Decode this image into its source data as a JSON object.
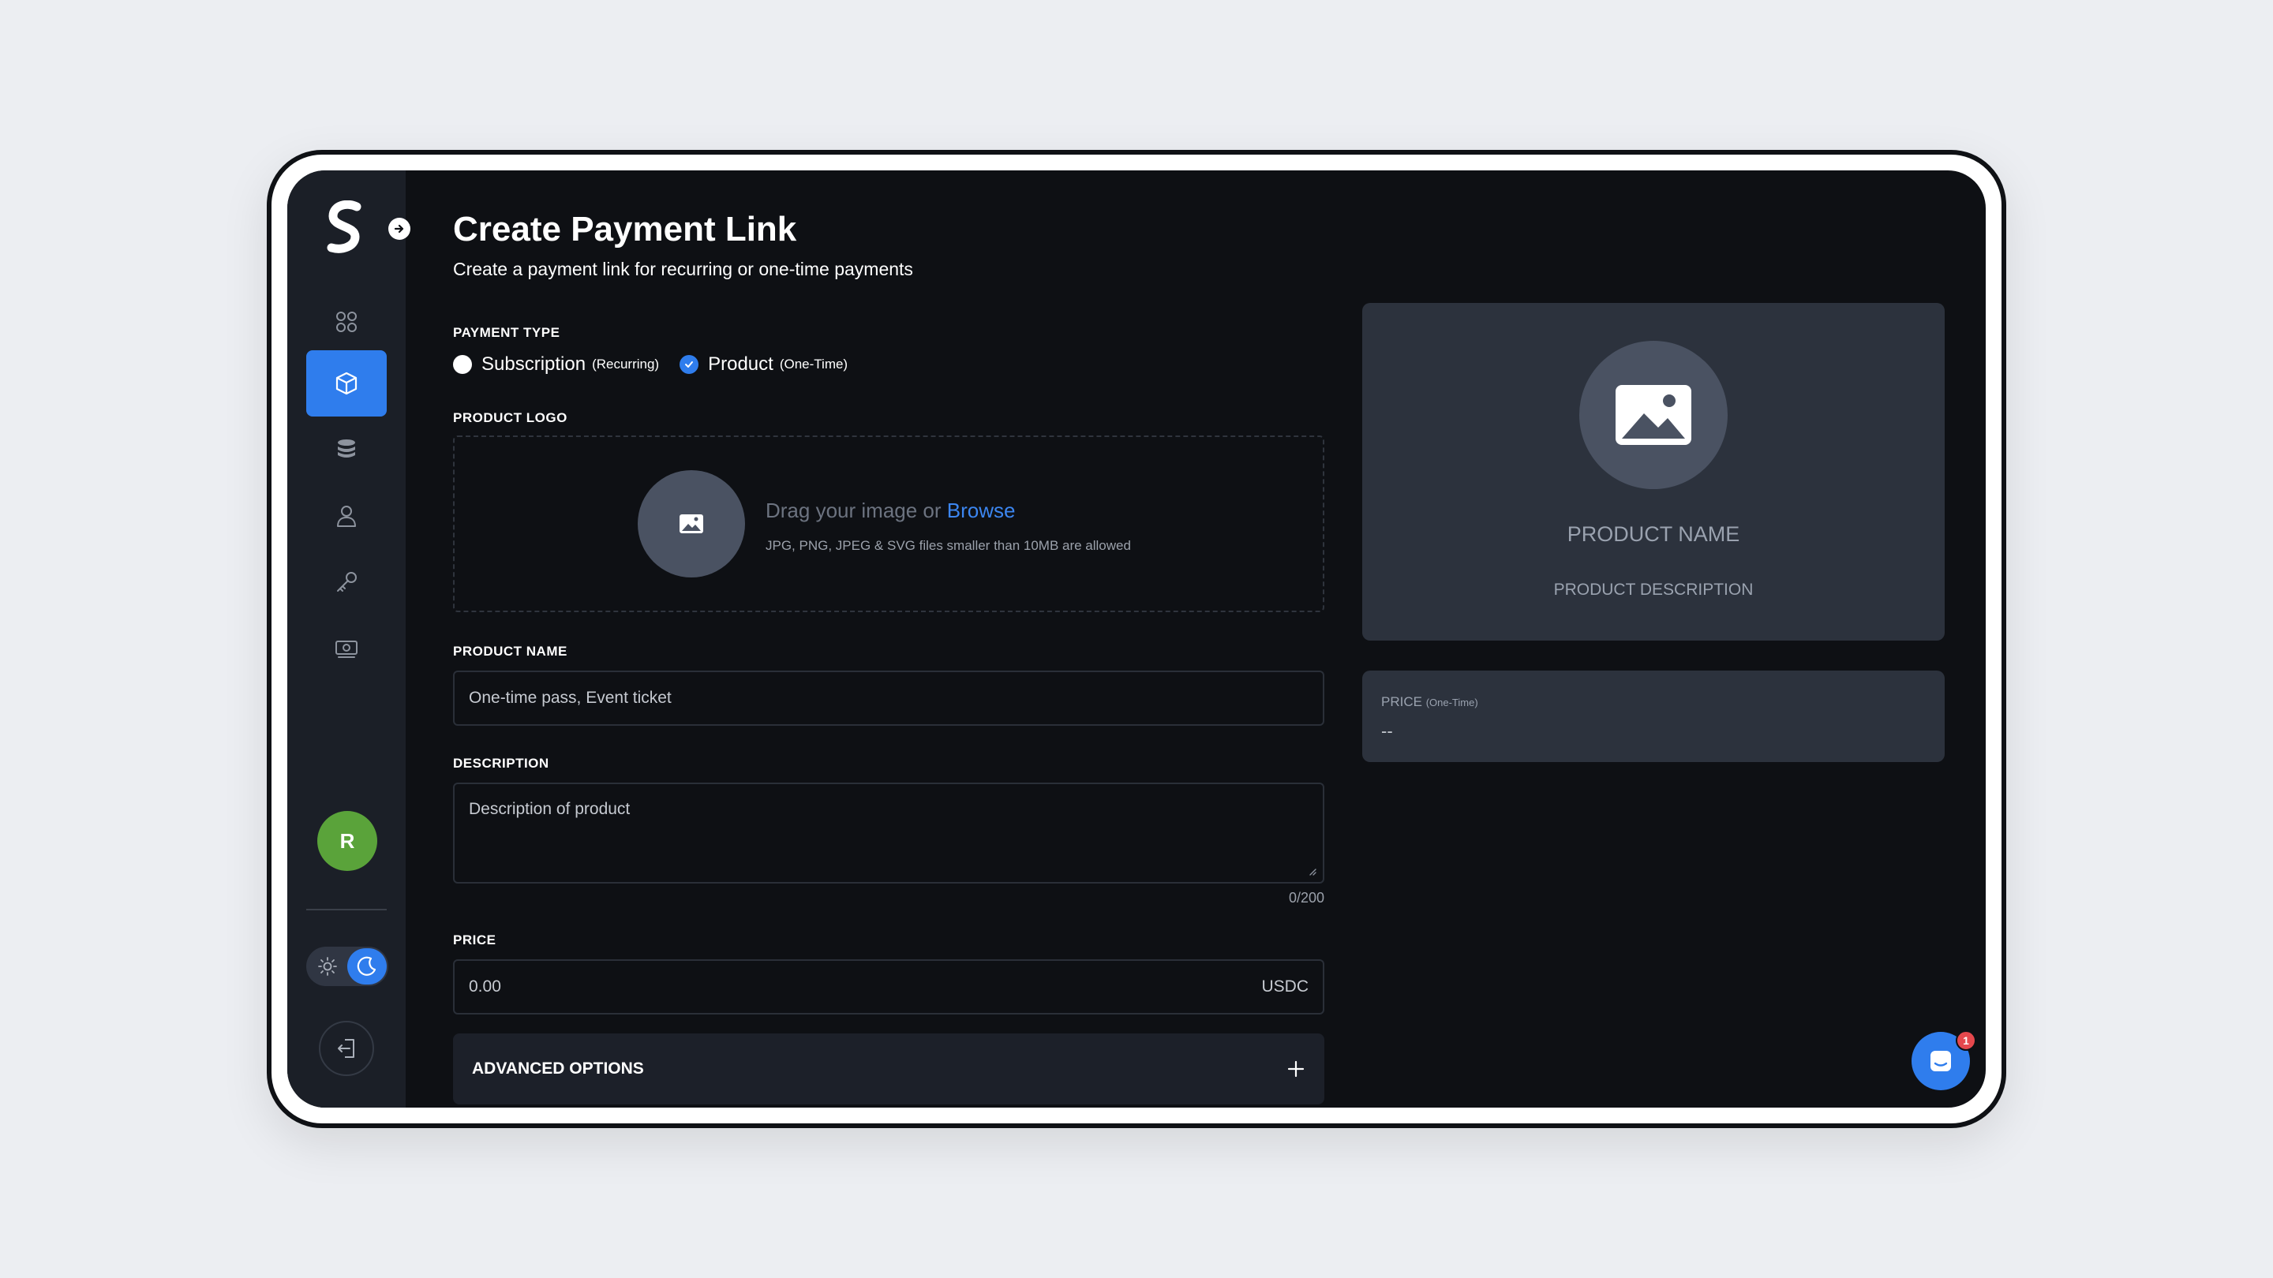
{
  "header": {
    "title": "Create Payment Link",
    "subtitle": "Create a payment link for recurring or one-time payments"
  },
  "sidebar": {
    "logo_icon": "s-logo-icon",
    "items": [
      {
        "icon": "grid-icon",
        "active": false
      },
      {
        "icon": "cube-icon",
        "active": true
      },
      {
        "icon": "coins-stack-icon",
        "active": false
      },
      {
        "icon": "user-icon",
        "active": false
      },
      {
        "icon": "key-icon",
        "active": false
      },
      {
        "icon": "money-icon",
        "active": false
      }
    ],
    "avatar_initial": "R",
    "theme": "dark"
  },
  "form": {
    "payment_type": {
      "label": "PAYMENT TYPE",
      "options": [
        {
          "label": "Subscription",
          "sub": "(Recurring)",
          "selected": false
        },
        {
          "label": "Product",
          "sub": "(One-Time)",
          "selected": true
        }
      ]
    },
    "product_logo": {
      "label": "PRODUCT LOGO",
      "drag_text": "Drag your image or",
      "browse_text": "Browse",
      "hint": "JPG, PNG, JPEG & SVG files smaller than 10MB are allowed"
    },
    "product_name": {
      "label": "PRODUCT NAME",
      "placeholder": "One-time pass, Event ticket"
    },
    "description": {
      "label": "DESCRIPTION",
      "placeholder": "Description of product",
      "counter": "0/200"
    },
    "price": {
      "label": "PRICE",
      "placeholder": "0.00",
      "currency": "USDC"
    },
    "advanced_options": {
      "label": "ADVANCED OPTIONS"
    }
  },
  "preview": {
    "product_name": "PRODUCT NAME",
    "product_description": "PRODUCT DESCRIPTION",
    "price_label": "PRICE",
    "price_sub": "(One-Time)",
    "price_value": "--"
  },
  "chat": {
    "badge_count": "1"
  },
  "colors": {
    "accent": "#2f7ded",
    "avatar": "#5aa33a",
    "badge": "#e5484d"
  }
}
